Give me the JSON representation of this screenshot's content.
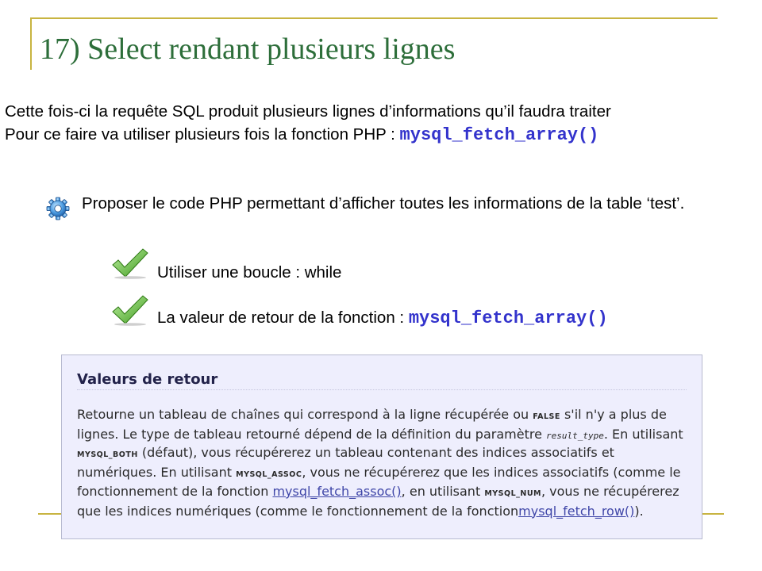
{
  "slide": {
    "title": "17) Select rendant plusieurs lignes",
    "intro_line1": "Cette fois-ci la requête SQL produit plusieurs lignes d’informations qu’il faudra traiter",
    "intro_line2_text": "Pour ce faire va utiliser plusieurs fois la fonction PHP : ",
    "intro_line2_code": "mysql_fetch_array()",
    "task": "Proposer le code PHP permettant d’afficher toutes les informations de la table ‘test’.",
    "hint1": "Utiliser une boucle : while",
    "hint2_text": "La valeur de retour de la fonction : ",
    "hint2_code": "mysql_fetch_array()"
  },
  "doc": {
    "heading": "Valeurs de retour",
    "p1": "Retourne un tableau de chaînes qui correspond à la ligne récupérée ou ",
    "false_const": "FALSE",
    "p2": " s'il n'y a plus de lignes. Le type de tableau retourné dépend de la définition du paramètre ",
    "param": "result_type",
    "p3": ". En utilisant ",
    "both_const": "MYSQL_BOTH",
    "p4": " (défaut), vous récupérerez un tableau contenant des indices associatifs et numériques. En utilisant ",
    "assoc_const": "MYSQL_ASSOC",
    "p5": ", vous ne récupérerez que les indices associatifs (comme le fonctionnement de la fonction ",
    "link_assoc": "mysql_fetch_assoc()",
    "p6": ", en utilisant ",
    "num_const": "MYSQL_NUM",
    "p7": ", vous ne récupérerez que les indices numériques (comme le fonctionnement de la fonction",
    "link_row": "mysql_fetch_row()",
    "p8": ")."
  },
  "colors": {
    "title": "#2d6e3a",
    "frame": "#c8b441",
    "code": "#3333cc",
    "doc_bg": "#eeeefd",
    "link": "#3f46a8"
  },
  "icons": {
    "task": "gear-icon",
    "hints": "checkmark-icon"
  }
}
